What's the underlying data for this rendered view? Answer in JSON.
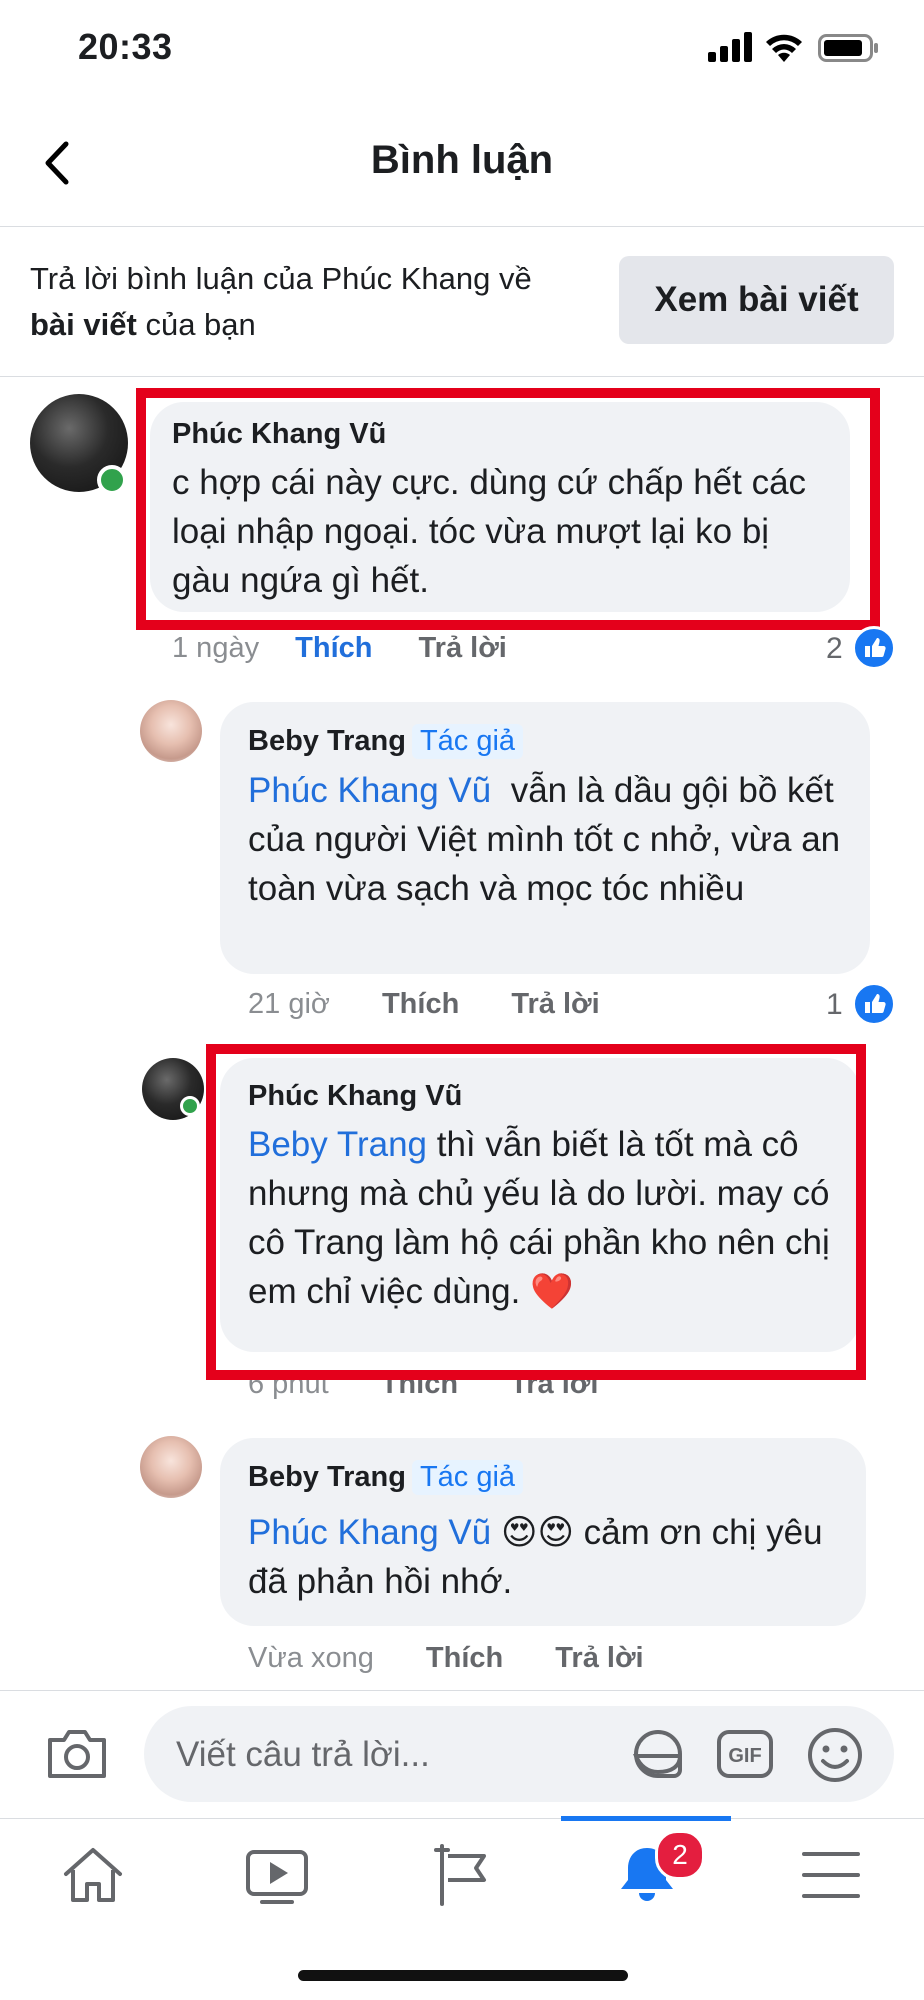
{
  "status_bar": {
    "time": "20:33"
  },
  "header": {
    "title": "Bình luận"
  },
  "context": {
    "text_part1": "Trả lời bình luận của Phúc Khang về",
    "text_bold": "bài viết",
    "text_part2": "của bạn",
    "view_post_label": "Xem bài viết"
  },
  "comments": [
    {
      "author": "Phúc Khang Vũ",
      "badge": "",
      "mention": "",
      "text": "c hợp cái này cực. dùng cứ chấp hết các loại nhập ngoại. tóc vừa mượt lại ko bị gàu ngứa gì hết.",
      "time": "1 ngày",
      "like_label": "Thích",
      "reply_label": "Trả lời",
      "reactions": "2",
      "liked": true
    },
    {
      "author": "Beby Trang",
      "badge": "Tác giả",
      "mention": "Phúc Khang Vũ",
      "text": "vẫn là dầu gội bồ kết của người Việt mình tốt c nhở, vừa an toàn vừa sạch và mọc tóc nhiều",
      "time": "21 giờ",
      "like_label": "Thích",
      "reply_label": "Trả lời",
      "reactions": "1",
      "liked": false
    },
    {
      "author": "Phúc Khang Vũ",
      "badge": "",
      "mention": "Beby Trang",
      "text": "thì vẫn biết là tốt mà cô nhưng mà chủ yếu là do lười. may có cô Trang làm hộ cái phần kho nên chị em chỉ việc dùng. ❤️",
      "time": "6 phút",
      "like_label": "Thích",
      "reply_label": "Trả lời",
      "reactions": "",
      "liked": false
    },
    {
      "author": "Beby Trang",
      "badge": "Tác giả",
      "mention": "Phúc Khang Vũ",
      "text": "😍😍 cảm ơn chị yêu đã phản hồi nhớ.",
      "time": "Vừa xong",
      "like_label": "Thích",
      "reply_label": "Trả lời",
      "reactions": "",
      "liked": false
    }
  ],
  "composer": {
    "placeholder": "Viết câu trả lời...",
    "gif_label": "GIF"
  },
  "tabbar": {
    "notification_count": "2"
  },
  "colors": {
    "highlight": "#e4001b",
    "link": "#216fdb",
    "bubble": "#f0f2f5",
    "like_blue": "#1877f2"
  }
}
